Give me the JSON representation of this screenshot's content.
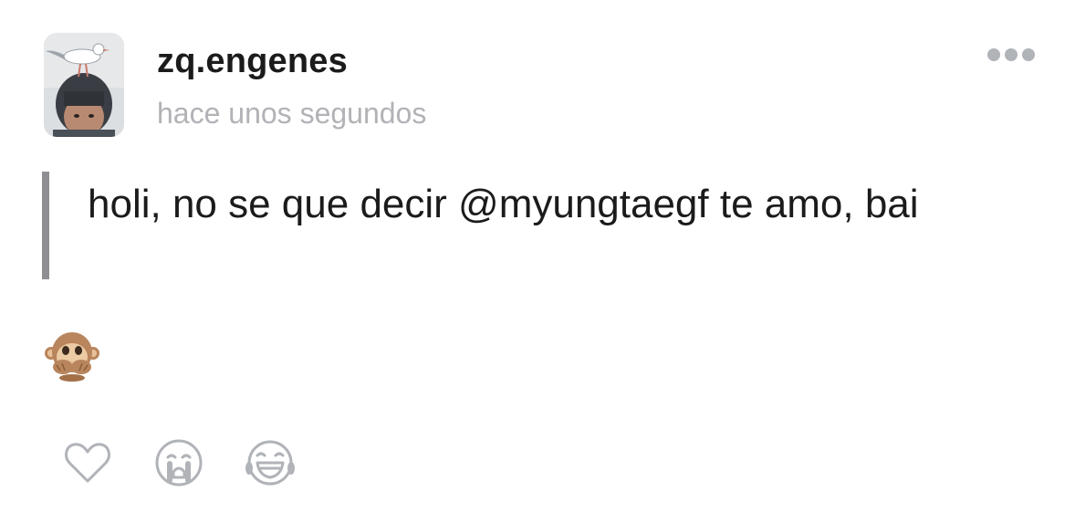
{
  "post": {
    "username": "zq.engenes",
    "timestamp": "hace unos segundos",
    "text": "holi, no se que decir @myungtaegf te amo, bai",
    "emoji": "see-no-evil-monkey",
    "avatar_icon": "avatar-photo-seagull-on-head"
  },
  "actions": {
    "items": [
      "heart-icon",
      "crying-face-icon",
      "laughing-face-icon"
    ]
  },
  "colors": {
    "username": "#1b1b1b",
    "timestamp": "#b2b2b7",
    "quote_bar": "#8e8e93",
    "icon_gray": "#b0b3b8"
  }
}
